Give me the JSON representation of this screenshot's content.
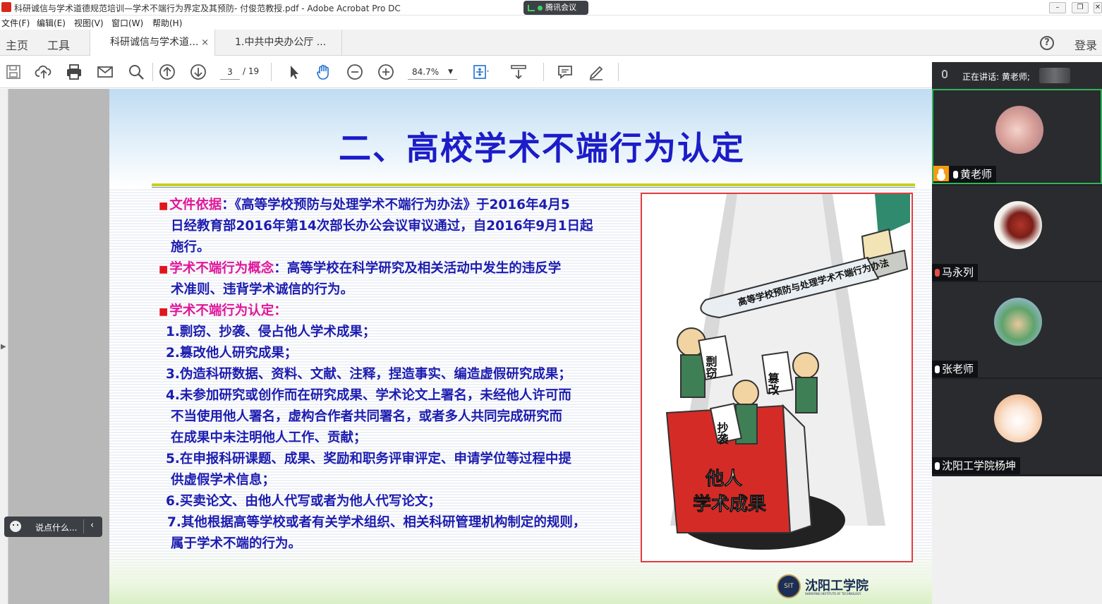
{
  "window": {
    "title": "科研诚信与学术道德规范培训—学术不端行为界定及其预防- 付俊范教授.pdf - Adobe Acrobat Pro DC",
    "meeting_pill": "腾讯会议"
  },
  "menu": [
    "文件(F)",
    "编辑(E)",
    "视图(V)",
    "窗口(W)",
    "帮助(H)"
  ],
  "tabs": {
    "home": "主页",
    "tools": "工具",
    "doc1": "科研诚信与学术道...",
    "doc1_close": "×",
    "doc2": "1.中共中央办公厅 ...",
    "login": "登录",
    "help": "?"
  },
  "toolbar": {
    "page_current": "3",
    "page_total": "/ 19",
    "zoom": "84.7%"
  },
  "slide": {
    "title": "二、高校学术不端行为认定",
    "lines": [
      {
        "bullet": "■",
        "label": "文件依据",
        "text": "：《高等学校预防与处理学术不端行为办法》于2016年4月5"
      },
      {
        "text": "日经教育部2016年第14次部长办公会议审议通过，自2016年9月1日起"
      },
      {
        "text": "施行。"
      },
      {
        "bullet": "■",
        "label": "学术不端行为概念",
        "text": "：高等学校在科学研究及相关活动中发生的违反学"
      },
      {
        "text": "术准则、违背学术诚信的行为。"
      },
      {
        "bullet": "■",
        "label": "学术不端行为认定",
        "text": "："
      },
      {
        "text": "1.剽窃、抄袭、侵占他人学术成果；"
      },
      {
        "text": "2.篡改他人研究成果；"
      },
      {
        "text": "3.伪造科研数据、资料、文献、注释，捏造事实、编造虚假研究成果；"
      },
      {
        "text": "4.未参加研究或创作而在研究成果、学术论文上署名，未经他人许可而"
      },
      {
        "text": "不当使用他人署名，虚构合作者共同署名，或者多人共同完成研究而"
      },
      {
        "text": "在成果中未注明他人工作、贡献；"
      },
      {
        "text": "5.在申报科研课题、成果、奖励和职务评审评定、申请学位等过程中提"
      },
      {
        "text": "供虚假学术信息；"
      },
      {
        "text": "6.买卖论文、由他人代写或者为他人代写论文；"
      },
      {
        "text": "7.其他根据高等学校或者有关学术组织、相关科研管理机构制定的规则，"
      },
      {
        "text": "属于学术不端的行为。"
      }
    ],
    "illustration": {
      "knife_text": "高等学校预防与处理学术不端行为办法",
      "sign1": "剽窃",
      "sign2": "篡改",
      "sign3": "抄袭",
      "book_line1": "他人",
      "book_line2": "学术成果"
    },
    "logo": {
      "badge": "SIT",
      "name": "沈阳工学院",
      "sub": "SHENYANG INSTITUTE OF TECHNOLOGY"
    }
  },
  "meeting": {
    "speaking": "正在讲话: 黄老师;",
    "participants": [
      {
        "name": "黄老师"
      },
      {
        "name": "马永列"
      },
      {
        "name": "张老师"
      },
      {
        "name": "沈阳工学院杨坤"
      }
    ]
  },
  "chat": {
    "placeholder": "说点什么..."
  },
  "colors": {
    "slide_title": "#1c1cc8",
    "slide_text": "#1c1cb0",
    "slide_highlight": "#e0169a",
    "bullet": "#e0161c",
    "meeting_active": "#2fb65a"
  }
}
